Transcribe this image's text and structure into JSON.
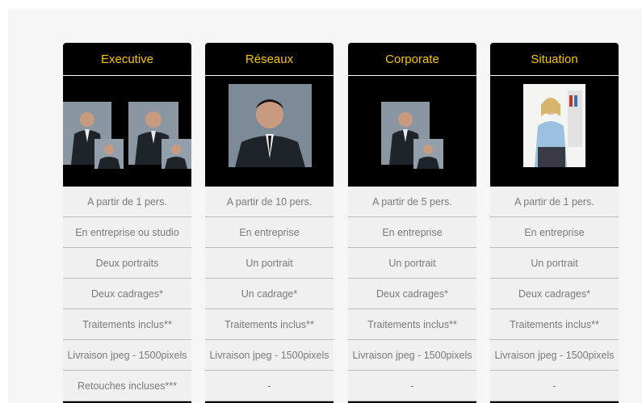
{
  "plans": [
    {
      "title": "Executive",
      "rows": [
        "A partir de 1 pers.",
        "En entreprise ou studio",
        "Deux portraits",
        "Deux cadrages*",
        "Traitements inclus**",
        "Livraison jpeg - 1500pixels",
        "Retouches incluses***"
      ]
    },
    {
      "title": "Réseaux",
      "rows": [
        "A partir de 10 pers.",
        "En entreprise",
        "Un portrait",
        "Un cadrage*",
        "Traitements inclus**",
        "Livraison jpeg - 1500pixels",
        "-"
      ]
    },
    {
      "title": "Corporate",
      "rows": [
        "A partir de 5 pers.",
        "En entreprise",
        "Un portrait",
        "Deux cadrages*",
        "Traitements inclus**",
        "Livraison jpeg - 1500pixels",
        "-"
      ]
    },
    {
      "title": "Situation",
      "rows": [
        "A partir de 1 pers.",
        "En entreprise",
        "Un portrait",
        "Deux cadrages*",
        "Traitements inclus**",
        "Livraison jpeg - 1500pixels",
        "-"
      ]
    }
  ],
  "colors": {
    "header_background": "#000000",
    "header_text": "#f5c500",
    "row_text": "#7a7a7a",
    "row_background": "#f0f0f0"
  }
}
